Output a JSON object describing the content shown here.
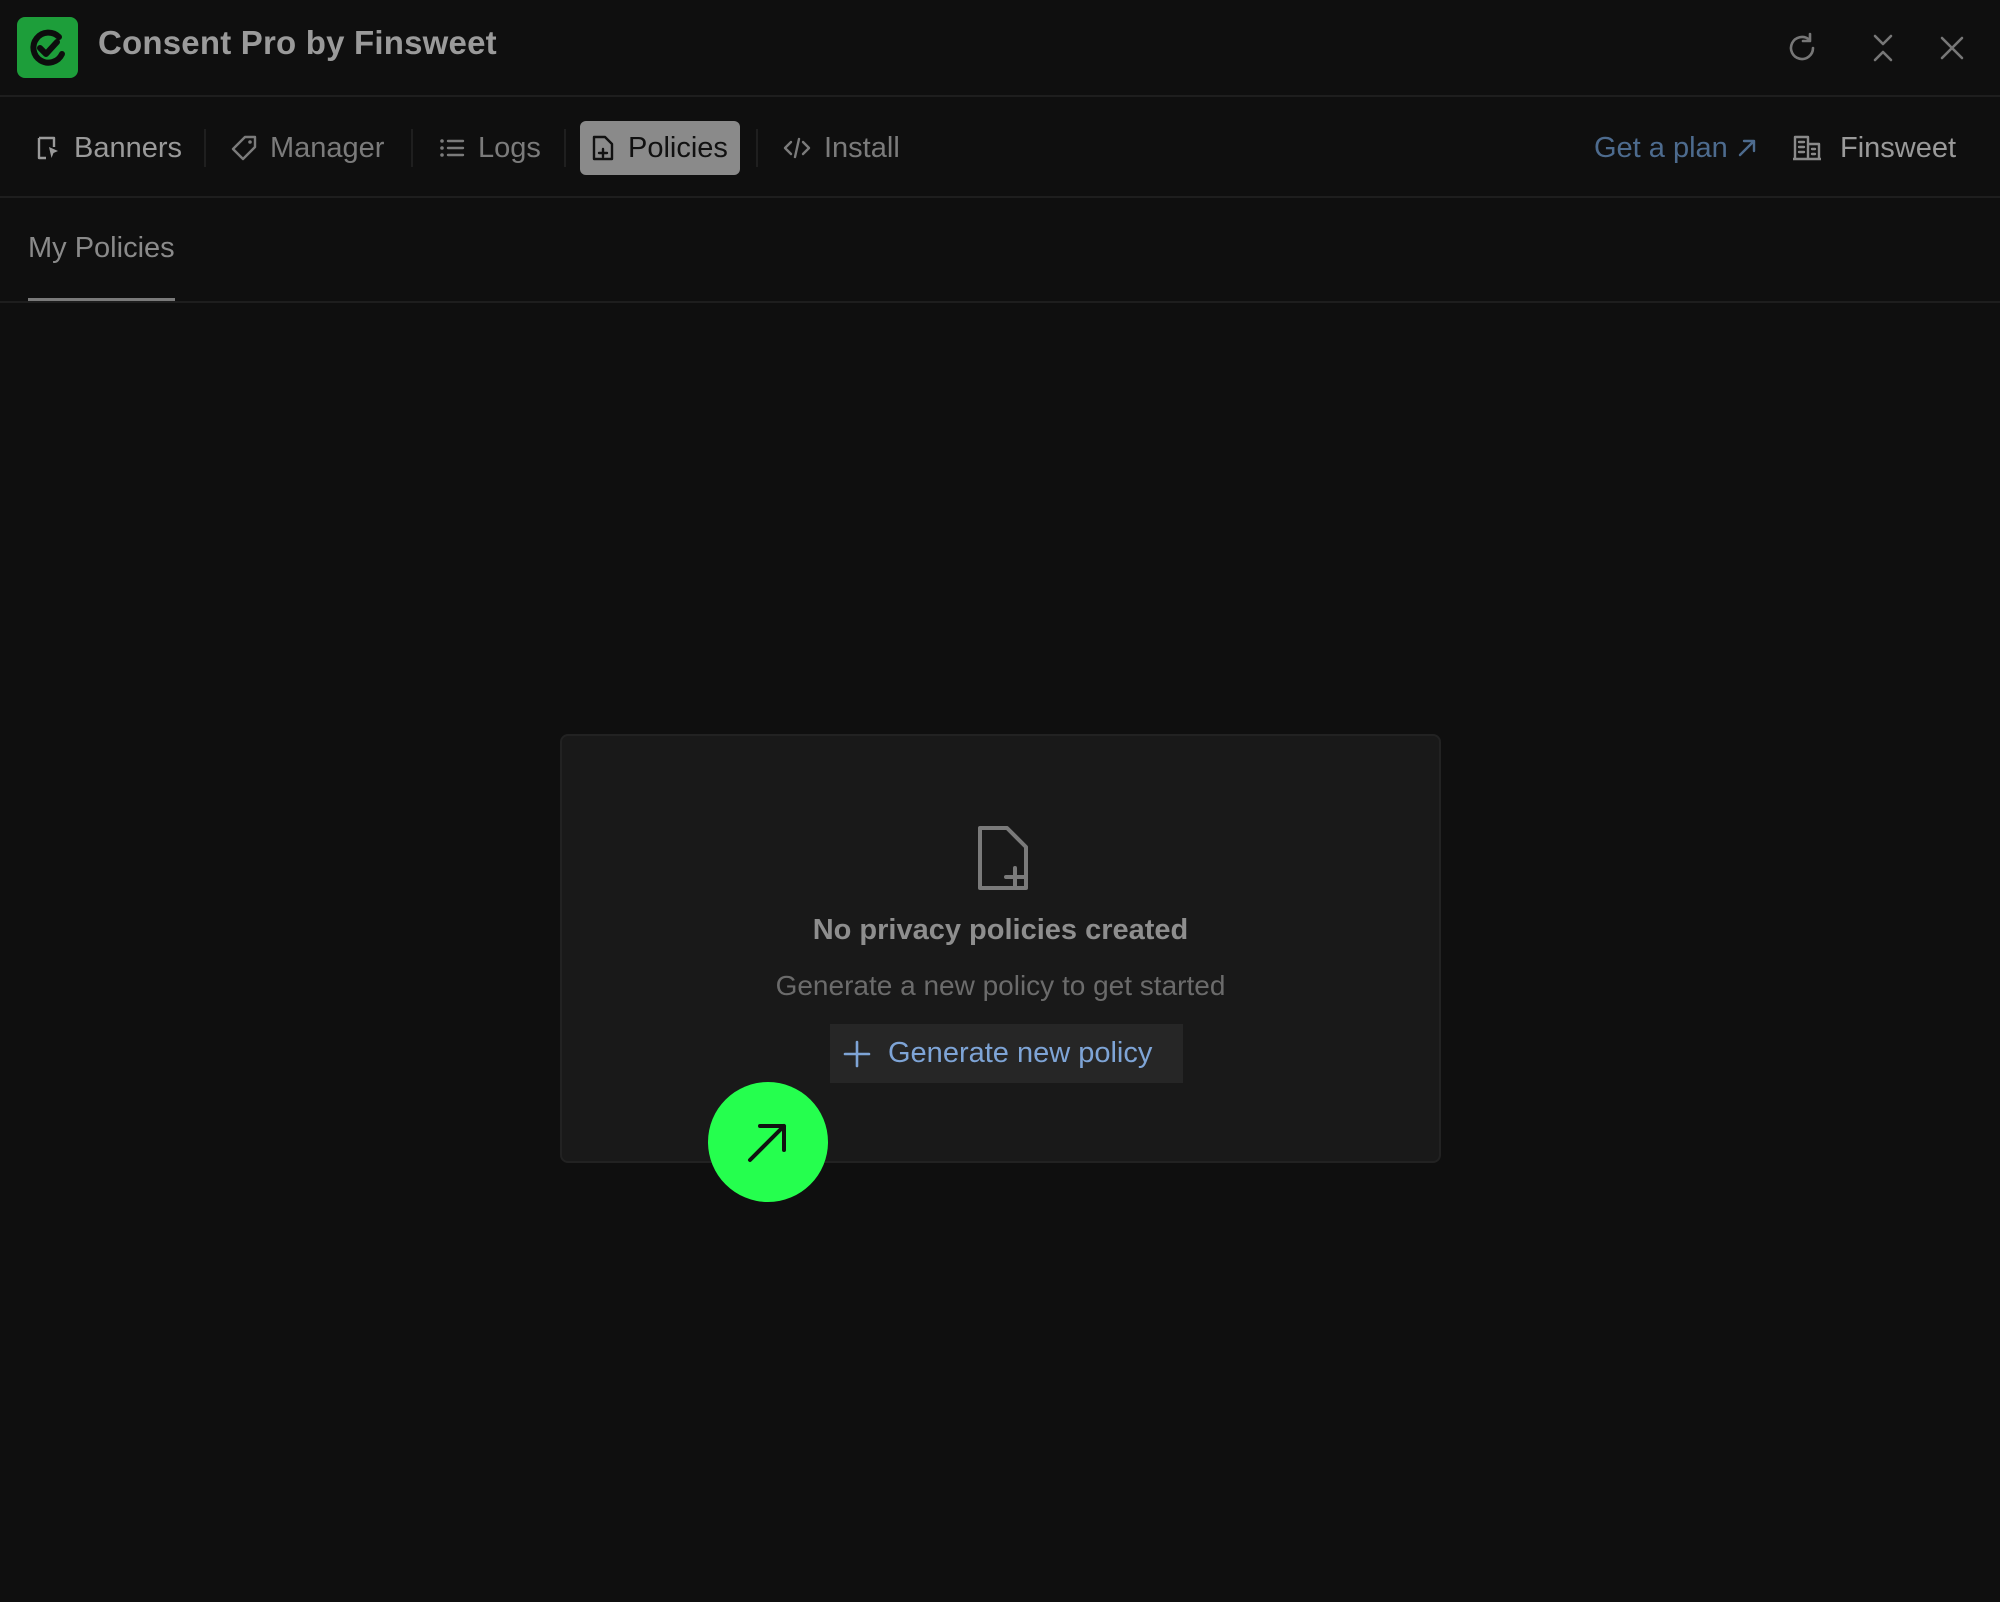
{
  "app": {
    "title": "Consent Pro by Finsweet",
    "brand_color": "#1d9e3a"
  },
  "window_controls": {
    "refresh": "refresh-icon",
    "collapse": "collapse-icon",
    "close": "close-icon"
  },
  "nav": {
    "items": [
      {
        "label": "Banners",
        "icon": "banner-icon"
      },
      {
        "label": "Manager",
        "icon": "tag-icon"
      },
      {
        "label": "Logs",
        "icon": "list-icon"
      },
      {
        "label": "Policies",
        "icon": "document-icon",
        "active": true
      },
      {
        "label": "Install",
        "icon": "code-icon"
      }
    ],
    "get_plan": "Get a plan",
    "workspace": "Finsweet"
  },
  "subtabs": {
    "items": [
      {
        "label": "My Policies",
        "active": true
      }
    ]
  },
  "empty_state": {
    "icon": "file-plus-icon",
    "heading": "No privacy policies created",
    "description": "Generate a new policy to get started",
    "button_label": "Generate new policy"
  },
  "overlay": {
    "icon": "arrow-up-right-icon",
    "color": "#25ff4e"
  }
}
